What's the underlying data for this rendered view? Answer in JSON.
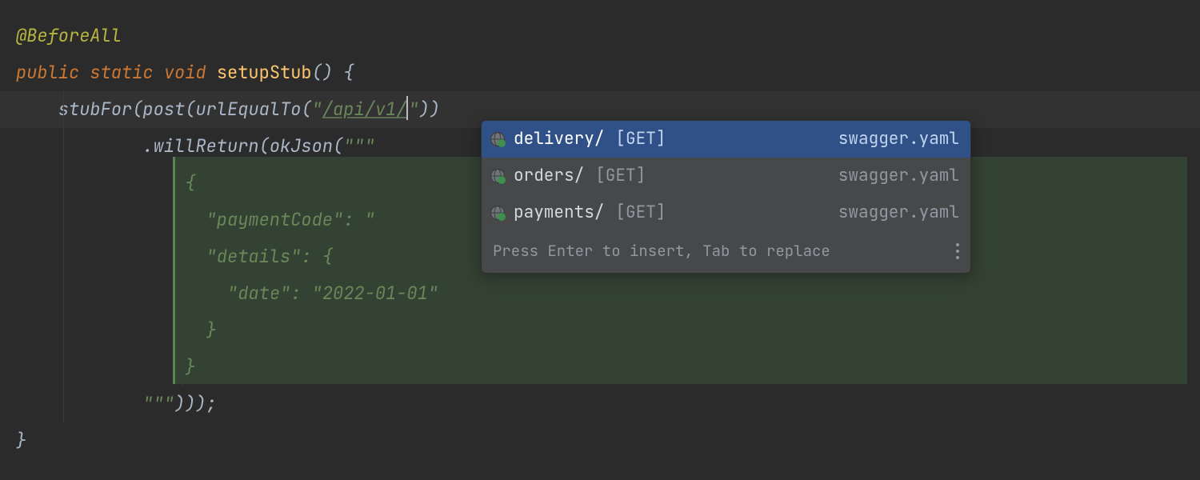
{
  "code": {
    "annotation": "@BeforeAll",
    "kw_public": "public",
    "kw_static": "static",
    "kw_void": "void",
    "method_name": "setupStub",
    "setup_open": "() {",
    "stubFor": "stubFor",
    "post": "post",
    "urlEqualTo": "urlEqualTo",
    "url_str_open": "\"",
    "url_str_value": "/api/v1/",
    "url_str_close": "\"",
    "line_close": "))",
    "willReturn": ".willReturn",
    "okJson": "okJson",
    "triple_open": "\"\"\"",
    "json_l1": "{",
    "json_l2a": "\"paymentCode\"",
    "json_l2b": ": ",
    "json_l2c": "\"",
    "json_l3a": "\"details\"",
    "json_l3b": ": {",
    "json_l4a": "\"date\"",
    "json_l4b": ": ",
    "json_l4c": "\"2022-01-01\"",
    "json_l5": "}",
    "json_l6": "}",
    "triple_close": "\"\"\"",
    "tail": ")));",
    "brace_close": "}"
  },
  "popup": {
    "items": [
      {
        "name": "delivery/",
        "verb": "[GET]",
        "file": "swagger.yaml",
        "selected": true
      },
      {
        "name": "orders/",
        "verb": "[GET]",
        "file": "swagger.yaml",
        "selected": false
      },
      {
        "name": "payments/",
        "verb": "[GET]",
        "file": "swagger.yaml",
        "selected": false
      }
    ],
    "hint": "Press Enter to insert, Tab to replace"
  }
}
